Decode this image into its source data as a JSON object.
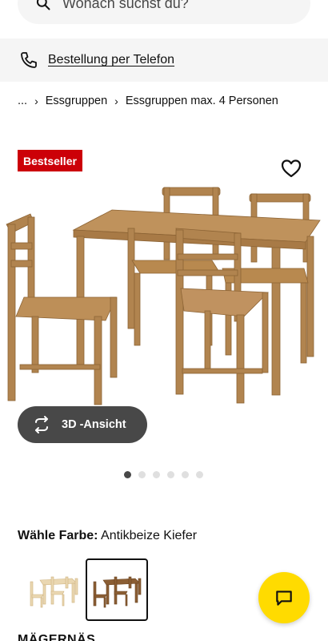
{
  "search": {
    "placeholder": "Wonach suchst du?"
  },
  "phone_banner": {
    "label": "Bestellung per Telefon"
  },
  "breadcrumb": {
    "ellipsis": "...",
    "items": [
      "Essgruppen",
      "Essgruppen max. 4 Personen"
    ]
  },
  "product": {
    "badge": "Bestseller",
    "view3d_label": "3D -Ansicht",
    "image_count": 6,
    "active_image": 1
  },
  "color": {
    "label": "Wähle Farbe:",
    "value": "Antikbeize Kiefer",
    "selected_swatch": 2
  },
  "next_section": {
    "heading": "MÄGERNÄS"
  },
  "colors": {
    "badge": "#cc0008",
    "chat_button": "#ffdb00",
    "dark_button": "#484848",
    "wood": "#b78b55"
  },
  "icons": {
    "search": "search-icon",
    "phone": "phone-icon",
    "favorite": "heart-icon",
    "rotate": "rotate-3d-icon",
    "chat": "chat-icon"
  }
}
